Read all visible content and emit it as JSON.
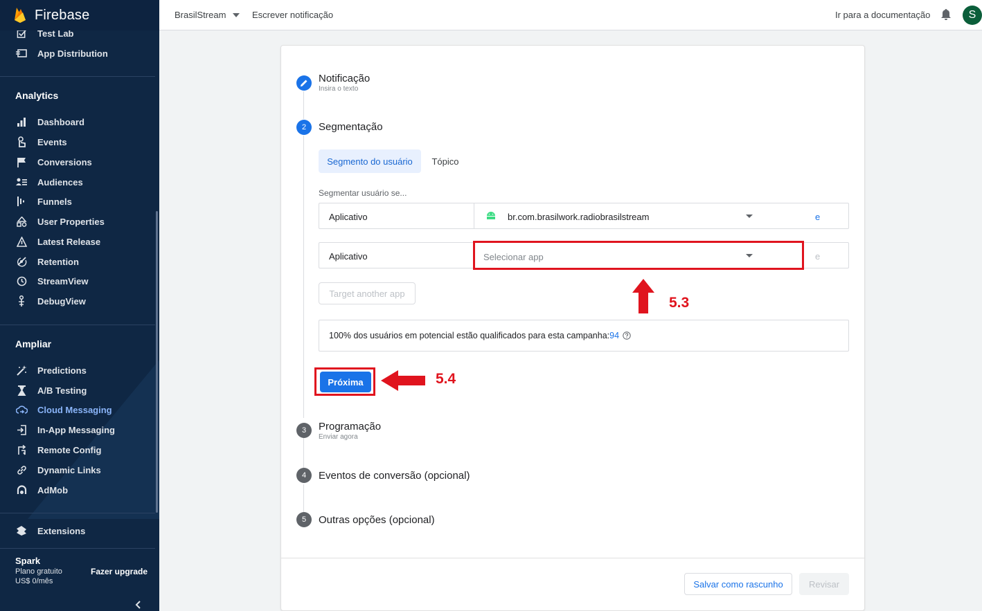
{
  "brand": {
    "name": "Firebase"
  },
  "sidebar": {
    "top_items": [
      {
        "label": "Test Lab"
      },
      {
        "label": "App Distribution"
      }
    ],
    "analytics": {
      "title": "Analytics",
      "items": [
        {
          "label": "Dashboard"
        },
        {
          "label": "Events"
        },
        {
          "label": "Conversions"
        },
        {
          "label": "Audiences"
        },
        {
          "label": "Funnels"
        },
        {
          "label": "User Properties"
        },
        {
          "label": "Latest Release"
        },
        {
          "label": "Retention"
        },
        {
          "label": "StreamView"
        },
        {
          "label": "DebugView"
        }
      ]
    },
    "ampliar": {
      "title": "Ampliar",
      "items": [
        {
          "label": "Predictions"
        },
        {
          "label": "A/B Testing"
        },
        {
          "label": "Cloud Messaging"
        },
        {
          "label": "In-App Messaging"
        },
        {
          "label": "Remote Config"
        },
        {
          "label": "Dynamic Links"
        },
        {
          "label": "AdMob"
        }
      ]
    },
    "extensions": {
      "label": "Extensions"
    },
    "plan": {
      "name": "Spark",
      "type": "Plano gratuito",
      "price": "US$ 0/mês",
      "upgrade": "Fazer upgrade"
    }
  },
  "topbar": {
    "project": "BrasilStream",
    "page_title": "Escrever notificação",
    "docs_link": "Ir para a documentação",
    "avatar_initial": "S"
  },
  "steps": [
    {
      "number": "",
      "title": "Notificação",
      "subtitle": "Insira o texto"
    },
    {
      "number": "2",
      "title": "Segmentação",
      "subtitle": ""
    },
    {
      "number": "3",
      "title": "Programação",
      "subtitle": "Enviar agora"
    },
    {
      "number": "4",
      "title": "Eventos de conversão (opcional)",
      "subtitle": ""
    },
    {
      "number": "5",
      "title": "Outras opções (opcional)",
      "subtitle": ""
    }
  ],
  "segmentation": {
    "tabs": [
      {
        "label": "Segmento do usuário",
        "selected": true
      },
      {
        "label": "Tópico",
        "selected": false
      }
    ],
    "segment_label": "Segmentar usuário se...",
    "rows": [
      {
        "label": "Aplicativo",
        "value": "br.com.brasilwork.radiobrasilstream",
        "and": "e"
      },
      {
        "label": "Aplicativo",
        "placeholder": "Selecionar app",
        "and": "e"
      }
    ],
    "target_another_app": "Target another app",
    "reach_text": "100% dos usuários em potencial estão qualificados para esta campanha:",
    "reach_count": "94",
    "next_button": "Próxima"
  },
  "annotations": {
    "label_53": "5.3",
    "label_54": "5.4",
    "color": "#e0141e"
  },
  "footer": {
    "save_draft": "Salvar como rascunho",
    "review": "Revisar"
  },
  "colors": {
    "sidebar_bg": "#0f2744",
    "accent": "#1a73e8",
    "active_nav": "#8ab4f8"
  }
}
